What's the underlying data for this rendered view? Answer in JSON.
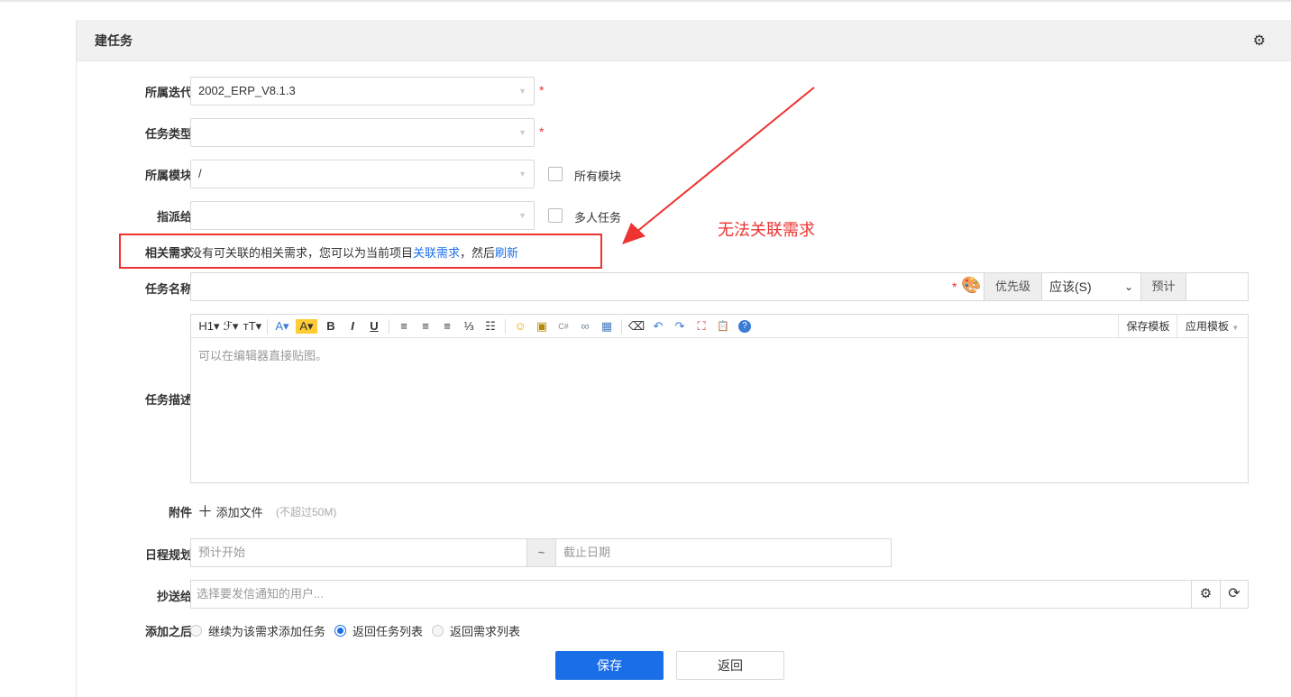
{
  "header": {
    "title": "建任务",
    "settings_icon": "gear-icon"
  },
  "form": {
    "iteration": {
      "label": "所属迭代",
      "value": "2002_ERP_V8.1.3",
      "required": "*"
    },
    "type": {
      "label": "任务类型",
      "value": "",
      "required": "*"
    },
    "module": {
      "label": "所属模块",
      "value": "/",
      "checkbox": "所有模块"
    },
    "assign": {
      "label": "指派给",
      "value": "",
      "checkbox": "多人任务"
    },
    "story": {
      "label": "相关需求",
      "text1": "没有可关联的相关需求，您可以为当前项目",
      "link1": "关联需求",
      "text2": "，然后",
      "link2": "刷新"
    },
    "name": {
      "label": "任务名称",
      "value": "",
      "required": "*",
      "priority_label": "优先级",
      "priority_value": "应该(S)",
      "estimate_label": "预计"
    },
    "desc": {
      "label": "任务描述",
      "placeholder": "可以在编辑器直接贴图。",
      "save_template": "保存模板",
      "apply_template": "应用模板",
      "toolbar": [
        "H1▾",
        "ℱ▾",
        "ᴛT▾",
        "A▾",
        "A▾",
        "B",
        "I",
        "U",
        "≡",
        "≡",
        "≡",
        "⅓",
        "☷",
        "☺",
        "▣",
        "C#",
        "∞",
        "▦",
        "⌫",
        "↶",
        "↷",
        "⛶",
        "📋",
        "?"
      ]
    },
    "attach": {
      "label": "附件",
      "add": "添加文件",
      "limit": "(不超过50M)"
    },
    "schedule": {
      "label": "日程规划",
      "start_placeholder": "预计开始",
      "sep": "~",
      "end_placeholder": "截止日期"
    },
    "cc": {
      "label": "抄送给",
      "placeholder": "选择要发信通知的用户..."
    },
    "after": {
      "label": "添加之后",
      "options": [
        "继续为该需求添加任务",
        "返回任务列表",
        "返回需求列表"
      ],
      "selected": 1
    },
    "save": "保存",
    "back": "返回"
  },
  "annotation": {
    "text": "无法关联需求",
    "color": "#ee3333"
  }
}
